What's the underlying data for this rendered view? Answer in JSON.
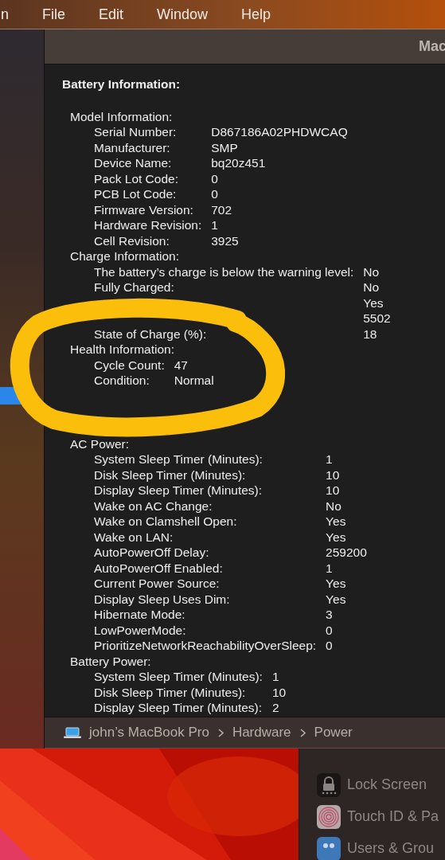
{
  "menu_bar": {
    "items": [
      "n",
      "File",
      "Edit",
      "Window",
      "Help"
    ]
  },
  "window": {
    "title": "Mac",
    "sections": [
      {
        "title": "Battery Information:",
        "groups": [
          {
            "heading": "Model Information:",
            "rows": [
              {
                "label": "Serial Number:",
                "value": "D867186A02PHDWCAQ"
              },
              {
                "label": "Manufacturer:",
                "value": "SMP"
              },
              {
                "label": "Device Name:",
                "value": "bq20z451"
              },
              {
                "label": "Pack Lot Code:",
                "value": "0"
              },
              {
                "label": "PCB Lot Code:",
                "value": "0"
              },
              {
                "label": "Firmware Version:",
                "value": "702"
              },
              {
                "label": "Hardware Revision:",
                "value": "1"
              },
              {
                "label": "Cell Revision:",
                "value": "3925"
              }
            ]
          },
          {
            "heading": "Charge Information:",
            "rows": [
              {
                "label": "The battery’s charge is below the warning level:",
                "value": "No"
              },
              {
                "label": "Fully Charged:",
                "value": "No"
              },
              {
                "value": "Yes"
              },
              {
                "value": "5502"
              },
              {
                "label": "State of Charge (%):",
                "value": "18"
              }
            ]
          },
          {
            "heading": "Health Information:",
            "rows": [
              {
                "label": "Cycle Count:",
                "value": "47"
              },
              {
                "label": "Condition:",
                "value": "Normal"
              }
            ]
          }
        ]
      },
      {
        "groups": [
          {
            "heading": "AC Power:",
            "rows": [
              {
                "label": "System Sleep Timer (Minutes):",
                "value": "1"
              },
              {
                "label": "Disk Sleep Timer (Minutes):",
                "value": "10"
              },
              {
                "label": "Display Sleep Timer (Minutes):",
                "value": "10"
              },
              {
                "label": "Wake on AC Change:",
                "value": "No"
              },
              {
                "label": "Wake on Clamshell Open:",
                "value": "Yes"
              },
              {
                "label": "Wake on LAN:",
                "value": "Yes"
              },
              {
                "label": "AutoPowerOff Delay:",
                "value": "259200"
              },
              {
                "label": "AutoPowerOff Enabled:",
                "value": "1"
              },
              {
                "label": "Current Power Source:",
                "value": "Yes"
              },
              {
                "label": "Display Sleep Uses Dim:",
                "value": "Yes"
              },
              {
                "label": "Hibernate Mode:",
                "value": "3"
              },
              {
                "label": "LowPowerMode:",
                "value": "0"
              },
              {
                "label": "PrioritizeNetworkReachabilityOverSleep:",
                "value": "0"
              }
            ]
          },
          {
            "heading": "Battery Power:",
            "rows": [
              {
                "label": "System Sleep Timer (Minutes):",
                "value": "1"
              },
              {
                "label": "Disk Sleep Timer (Minutes):",
                "value": "10"
              },
              {
                "label": "Display Sleep Timer (Minutes):",
                "value": "2"
              }
            ]
          }
        ]
      }
    ],
    "breadcrumb": [
      "john’s MacBook Pro",
      "Hardware",
      "Power"
    ]
  },
  "settings_sidebar": {
    "items": [
      {
        "label": "Lock Screen",
        "kind": "lock"
      },
      {
        "label": "Touch ID & Pa",
        "kind": "fingerprint"
      },
      {
        "label": "Users & Grou",
        "kind": "users"
      }
    ]
  }
}
